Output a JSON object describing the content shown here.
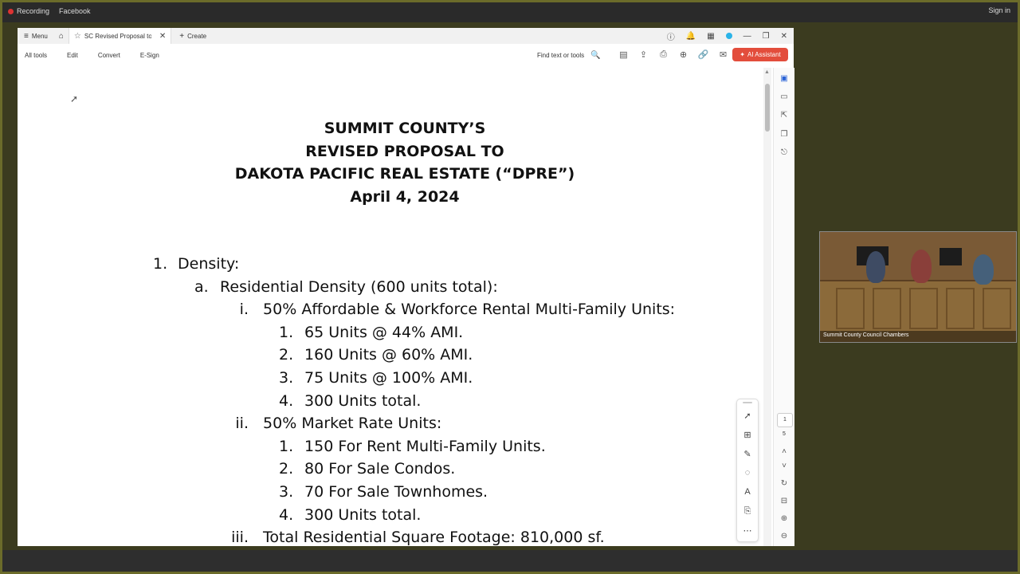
{
  "sysbar": {
    "recording": "Recording",
    "facebook": "Facebook",
    "signin": "Sign in"
  },
  "tabs": {
    "menu": "Menu",
    "doc_title": "SC Revised Proposal to ...",
    "create": "Create"
  },
  "toolbar": {
    "items": [
      "All tools",
      "Edit",
      "Convert",
      "E-Sign"
    ],
    "find": "Find text or tools",
    "ai": "AI Assistant"
  },
  "doc": {
    "title_lines": [
      "SUMMIT COUNTY’S",
      "REVISED PROPOSAL TO",
      "DAKOTA PACIFIC REAL ESTATE (“DPRE”)",
      "April 4, 2024"
    ],
    "outline": [
      {
        "num": "1.",
        "text": "Density:"
      },
      {
        "num": "a.",
        "text": "Residential Density (600 units total):"
      },
      {
        "num": "i.",
        "text": "50% Affordable & Workforce Rental Multi-Family Units:"
      },
      {
        "num": "1.",
        "text": "65 Units @ 44% AMI."
      },
      {
        "num": "2.",
        "text": "160 Units @ 60% AMI."
      },
      {
        "num": "3.",
        "text": "75 Units @ 100% AMI."
      },
      {
        "num": "4.",
        "text": "300 Units total."
      },
      {
        "num": "ii.",
        "text": "50% Market Rate Units:"
      },
      {
        "num": "1.",
        "text": "150 For Rent Multi-Family Units."
      },
      {
        "num": "2.",
        "text": "80 For Sale Condos."
      },
      {
        "num": "3.",
        "text": "70 For Sale Townhomes."
      },
      {
        "num": "4.",
        "text": "300 Units total."
      },
      {
        "num": "iii.",
        "text": "Total Residential Square Footage: 810,000 sf."
      }
    ]
  },
  "pager": {
    "current": "1",
    "total": "5"
  },
  "video": {
    "caption": "Summit County Council Chambers"
  }
}
